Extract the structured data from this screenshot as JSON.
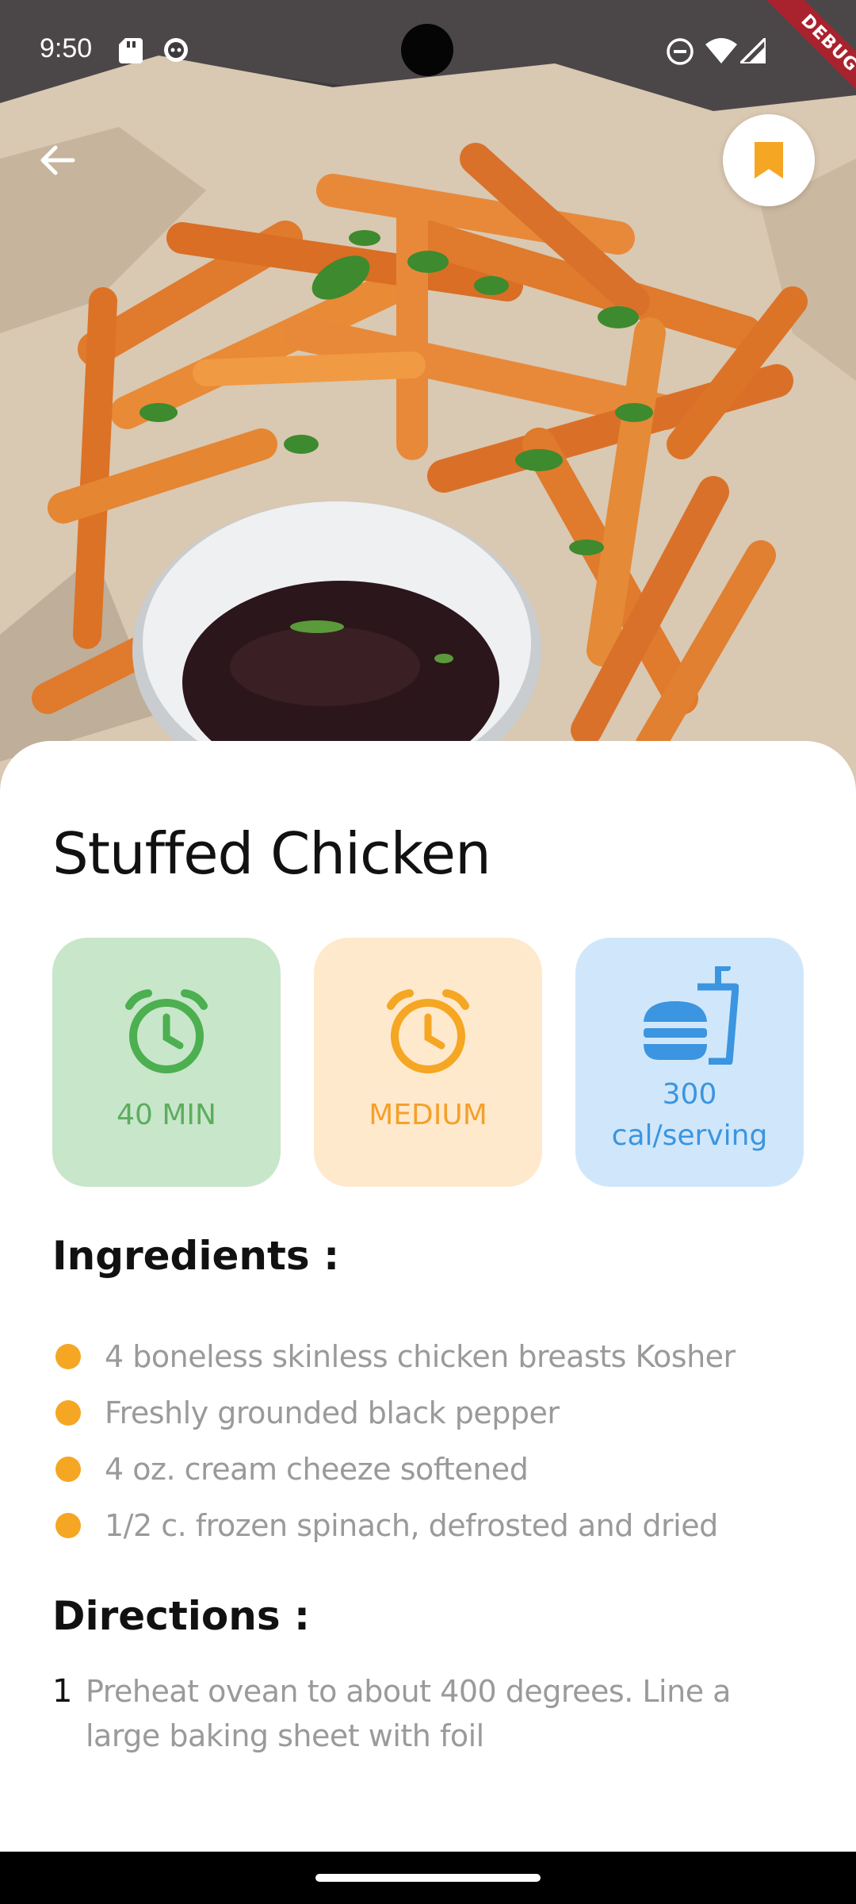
{
  "status_bar": {
    "time": "9:50"
  },
  "debug_banner": "DEBUG",
  "recipe": {
    "title": "Stuffed Chicken",
    "stats": {
      "time": "40 MIN",
      "difficulty": "MEDIUM",
      "calories_value": "300",
      "calories_unit": "cal/serving"
    },
    "ingredients_title": "Ingredients :",
    "ingredients": [
      "4 boneless skinless chicken breasts Kosher",
      "Freshly grounded black pepper",
      "4 oz. cream cheeze softened",
      "1/2 c. frozen spinach, defrosted and dried"
    ],
    "directions_title": "Directions :",
    "directions": [
      {
        "num": "1",
        "text": "Preheat ovean to about 400 degrees. Line a large baking sheet with foil"
      }
    ]
  },
  "colors": {
    "accent_orange": "#f5a623",
    "time_card_bg": "#c8e6c9",
    "difficulty_card_bg": "#ffe9cc",
    "calories_card_bg": "#d0e7fb"
  },
  "icons": {
    "back": "arrow-left-icon",
    "bookmark": "bookmark-icon",
    "time": "alarm-clock-icon",
    "difficulty": "alarm-clock-icon",
    "calories": "fast-food-icon"
  }
}
